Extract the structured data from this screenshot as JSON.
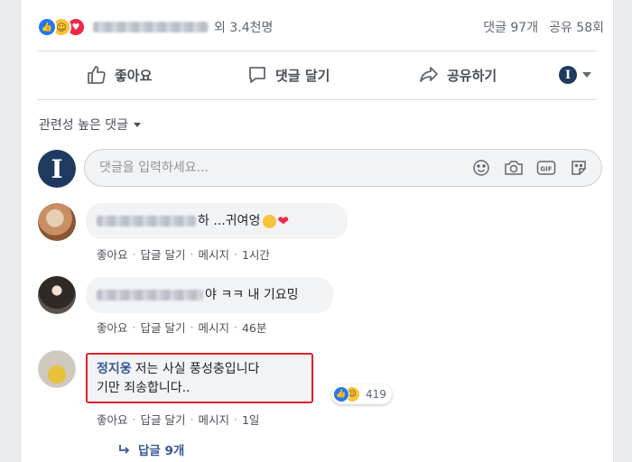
{
  "post_summary": {
    "reactors_suffix": "외 3.4천명",
    "comment_count": "댓글 97개",
    "share_count": "공유 58회"
  },
  "actions": {
    "like": "좋아요",
    "comment": "댓글 달기",
    "share": "공유하기"
  },
  "current_user": {
    "avatar_initial": "I"
  },
  "sort": {
    "label": "관련성 높은 댓글"
  },
  "compose": {
    "placeholder": "댓글을 입력하세요..."
  },
  "comments": [
    {
      "text": "하 ...귀여엉",
      "meta": {
        "like": "좋아요",
        "reply": "답글 달기",
        "message": "메시지",
        "time": "1시간"
      }
    },
    {
      "text": "야 ㅋㅋ 내 기요밍",
      "meta": {
        "like": "좋아요",
        "reply": "답글 달기",
        "message": "메시지",
        "time": "46분"
      }
    },
    {
      "author": "정지웅",
      "text_line1": "저는 사실 풍성충입니다",
      "text_line2": "기만 죄송합니다..",
      "reaction_count": "419",
      "meta": {
        "like": "좋아요",
        "reply": "답글 달기",
        "message": "메시지",
        "time": "1일"
      },
      "replies": "답글 9개"
    }
  ],
  "separator": "·",
  "colors": {
    "link_blue": "#385898",
    "like_blue": "#2078f4",
    "highlight_red": "#e0202a",
    "love_red": "#f0284a",
    "haha_yellow": "#f7c33b"
  }
}
